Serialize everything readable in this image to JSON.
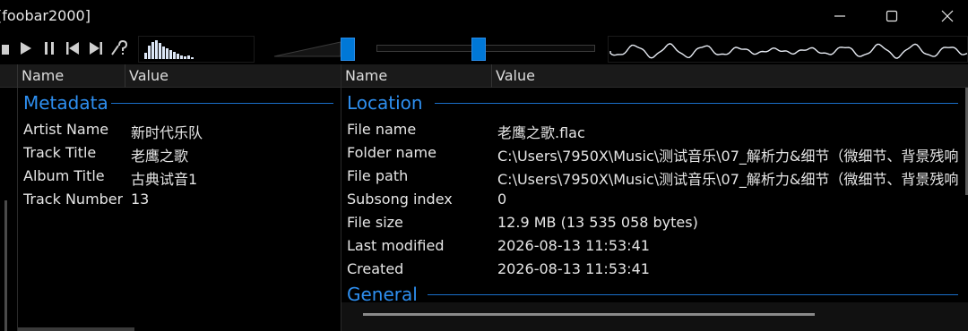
{
  "window": {
    "title": "[foobar2000]",
    "controls": [
      "minimize-icon",
      "maximize-icon",
      "close-icon"
    ]
  },
  "toolbar": {
    "buttons": [
      "stop-icon",
      "play-icon",
      "pause-icon",
      "previous-icon",
      "next-icon",
      "random-icon"
    ],
    "spectrum_levels": [
      0.3,
      0.7,
      0.85,
      0.95,
      0.8,
      0.65,
      0.55,
      0.45,
      0.35,
      0.25,
      0.2,
      0.15,
      0.2,
      0.1
    ],
    "volume_level": 1.0,
    "seek_position": 0.45
  },
  "left_panel": {
    "columns": [
      "Name",
      "Value"
    ],
    "group": "Metadata",
    "rows": [
      {
        "name": "Artist Name",
        "value": "新时代乐队"
      },
      {
        "name": "Track Title",
        "value": "老鹰之歌"
      },
      {
        "name": "Album Title",
        "value": "古典试音1"
      },
      {
        "name": "Track Number",
        "value": "13"
      }
    ]
  },
  "right_panel": {
    "columns": [
      "Name",
      "Value"
    ],
    "groups": [
      {
        "label": "Location",
        "rows": [
          {
            "name": "File name",
            "value": "老鹰之歌.flac"
          },
          {
            "name": "Folder name",
            "value": "C:\\Users\\7950X\\Music\\测试音乐\\07_解析力&细节（微细节、背景残响"
          },
          {
            "name": "File path",
            "value": "C:\\Users\\7950X\\Music\\测试音乐\\07_解析力&细节（微细节、背景残响"
          },
          {
            "name": "Subsong index",
            "value": "0"
          },
          {
            "name": "File size",
            "value": "12.9 MB (13 535 058 bytes)"
          },
          {
            "name": "Last modified",
            "value": "2026-08-13 11:53:41"
          },
          {
            "name": "Created",
            "value": "2026-08-13 11:53:41"
          }
        ]
      },
      {
        "label": "General",
        "rows": []
      }
    ]
  },
  "colors": {
    "accent": "#0078d7",
    "group_text": "#2e8ff0",
    "background": "#000000",
    "header_bg": "#1a1a1a"
  }
}
